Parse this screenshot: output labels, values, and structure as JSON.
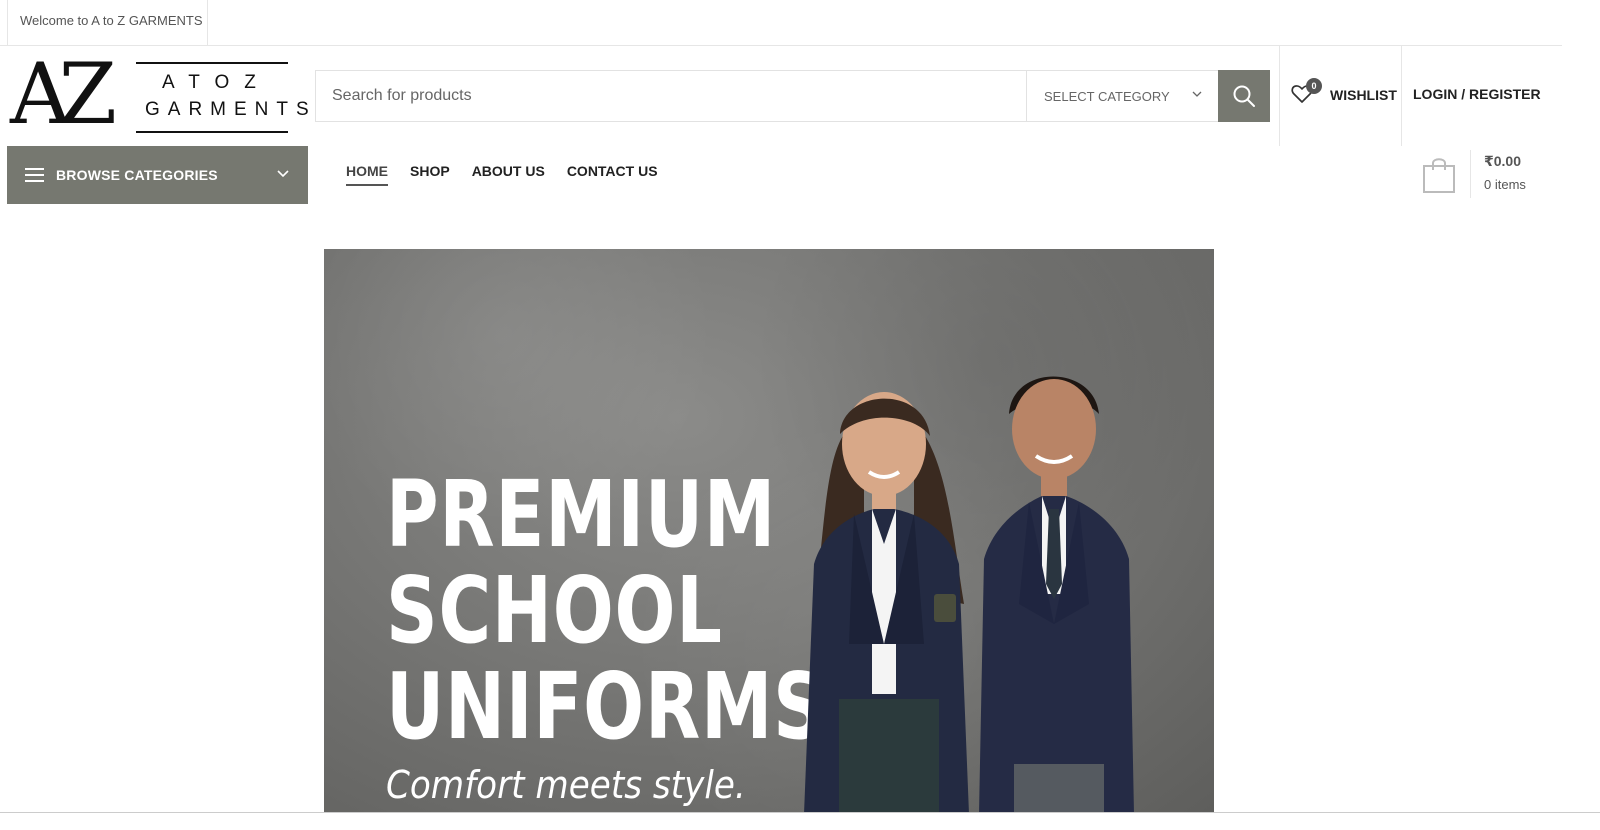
{
  "topbar": {
    "welcome": "Welcome to A to Z GARMENTS"
  },
  "logo": {
    "mark": "AZ",
    "line1": "ATOZ",
    "line2": "GARMENTS"
  },
  "search": {
    "placeholder": "Search for products",
    "category_label": "SELECT CATEGORY"
  },
  "header": {
    "wishlist_label": "WISHLIST",
    "wishlist_count": "0",
    "login_label": "LOGIN / REGISTER"
  },
  "cart": {
    "total": "₹0.00",
    "items": "0 items"
  },
  "nav": {
    "browse_label": "BROWSE CATEGORIES",
    "items": [
      {
        "label": "HOME",
        "active": true
      },
      {
        "label": "SHOP"
      },
      {
        "label": "ABOUT US"
      },
      {
        "label": "CONTACT US"
      }
    ]
  },
  "hero": {
    "lines": [
      "PREMIUM",
      "SCHOOL",
      "UNIFORMS"
    ],
    "tagline": "Comfort meets style."
  },
  "colors": {
    "accent": "#767870",
    "text": "#222222"
  },
  "icons": {
    "search": "search-icon",
    "wishlist": "heart-icon",
    "cart": "shopping-bag-icon",
    "menu": "hamburger-menu-icon"
  }
}
